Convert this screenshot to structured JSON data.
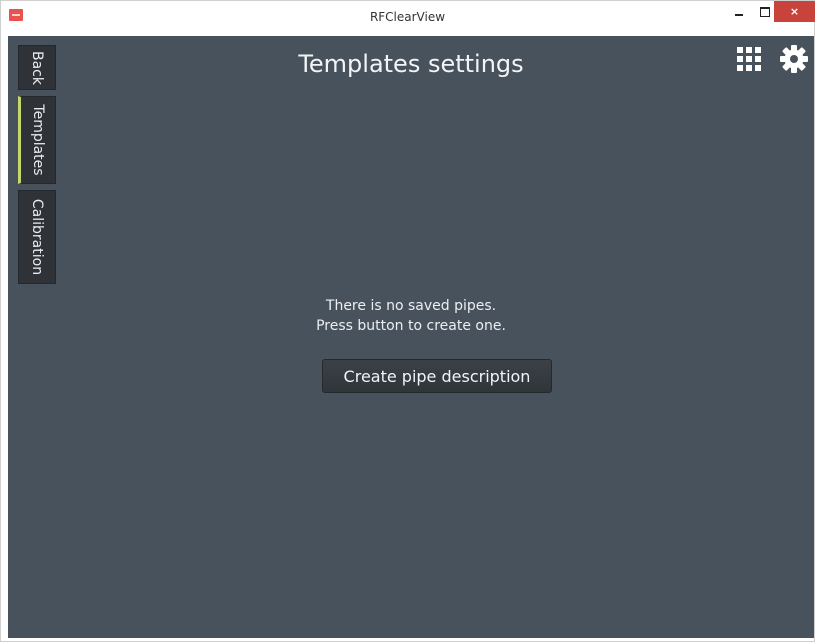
{
  "window": {
    "title": "RFClearView",
    "close_glyph": "×"
  },
  "sidebar": {
    "tabs": [
      {
        "label": "Back",
        "active": false
      },
      {
        "label": "Templates",
        "active": true
      },
      {
        "label": "Calibration",
        "active": false
      }
    ]
  },
  "header": {
    "title": "Templates settings",
    "icons": [
      "grid-icon",
      "gear-icon"
    ]
  },
  "main": {
    "empty_line1": "There is no saved pipes.",
    "empty_line2": "Press button to create one.",
    "create_button_label": "Create pipe description"
  },
  "colors": {
    "background": "#48525d",
    "tab": "#2f3338",
    "active_indicator": "#c7d86b",
    "close_button": "#c7433b"
  }
}
